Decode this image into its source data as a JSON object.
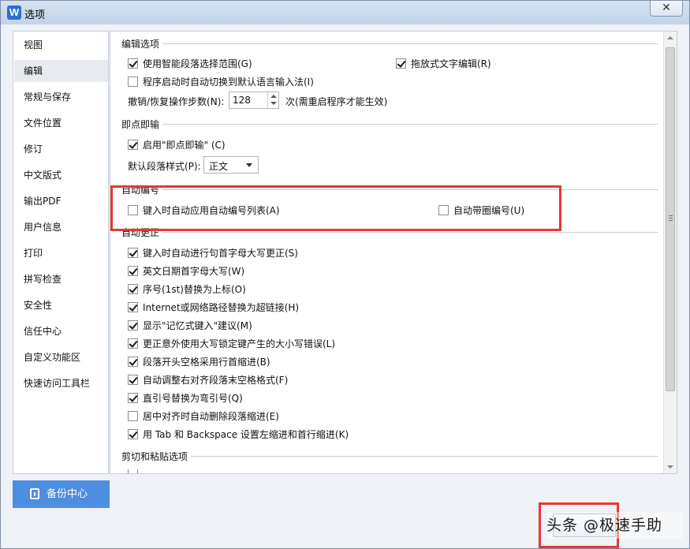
{
  "window": {
    "title": "选项",
    "app_icon_letter": "W"
  },
  "sidebar": {
    "items": [
      {
        "label": "视图"
      },
      {
        "label": "编辑",
        "active": true
      },
      {
        "label": "常规与保存"
      },
      {
        "label": "文件位置"
      },
      {
        "label": "修订"
      },
      {
        "label": "中文版式"
      },
      {
        "label": "输出PDF"
      },
      {
        "label": "用户信息"
      },
      {
        "label": "打印"
      },
      {
        "label": "拼写检查"
      },
      {
        "label": "安全性"
      },
      {
        "label": "信任中心"
      },
      {
        "label": "自定义功能区"
      },
      {
        "label": "快速访问工具栏"
      }
    ],
    "backup_label": "备份中心"
  },
  "sections": {
    "edit": {
      "title": "编辑选项",
      "smart_select": {
        "label": "使用智能段落选择范围(G)",
        "checked": true
      },
      "drag_drop": {
        "label": "拖放式文字编辑(R)",
        "checked": true
      },
      "auto_ime": {
        "label": "程序启动时自动切换到默认语言输入法(I)",
        "checked": false
      },
      "undo_label": "撤销/恢复操作步数(N):",
      "undo_value": "128",
      "undo_note": "次(需重启程序才能生效)"
    },
    "instant_input": {
      "title": "即点即输",
      "enable": {
        "label": "启用\"即点即输\" (C)",
        "checked": true
      },
      "default_style_label": "默认段落样式(P):",
      "default_style_value": "正文"
    },
    "auto_number": {
      "title": "自动编号",
      "auto_list": {
        "label": "键入时自动应用自动编号列表(A)",
        "checked": false
      },
      "circled": {
        "label": "自动带圈编号(U)",
        "checked": false
      }
    },
    "autocorrect": {
      "title": "自动更正",
      "items": [
        {
          "label": "键入时自动进行句首字母大写更正(S)",
          "checked": true
        },
        {
          "label": "英文日期首字母大写(W)",
          "checked": true
        },
        {
          "label": "序号(1st)替换为上标(O)",
          "checked": true
        },
        {
          "label": "Internet或网络路径替换为超链接(H)",
          "checked": true
        },
        {
          "label": "显示\"记忆式键入\"建议(M)",
          "checked": true
        },
        {
          "label": "更正意外使用大写锁定键产生的大小写错误(L)",
          "checked": true
        },
        {
          "label": "段落开头空格采用行首缩进(B)",
          "checked": true
        },
        {
          "label": "自动调整右对齐段落末空格格式(F)",
          "checked": true
        },
        {
          "label": "直引号替换为弯引号(Q)",
          "checked": true
        },
        {
          "label": "居中对齐时自动删除段落缩进(E)",
          "checked": false
        },
        {
          "label": "用 Tab 和 Backspace 设置左缩进和首行缩进(K)",
          "checked": true
        }
      ]
    },
    "cut_paste": {
      "title": "剪切和粘贴选项"
    }
  },
  "watermark": "头条 @极速手助",
  "colors": {
    "highlight": "#e53935",
    "accent": "#4e8ee0"
  }
}
